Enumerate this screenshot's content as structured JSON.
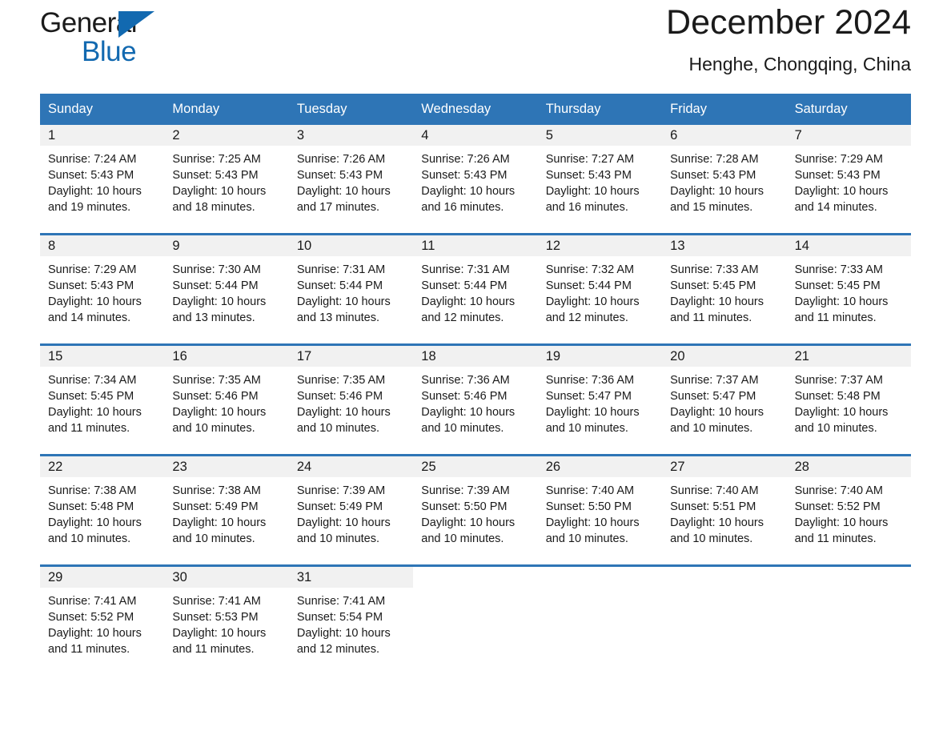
{
  "brand": {
    "name_part1": "General",
    "name_part2": "Blue",
    "triangle_color": "#1269b0"
  },
  "header": {
    "title": "December 2024",
    "subtitle": "Henghe, Chongqing, China"
  },
  "theme": {
    "header_bg": "#2e75b6",
    "header_text": "#ffffff",
    "daynum_bg": "#f1f1f1",
    "rule_color": "#2e75b6",
    "text": "#1a1a1a"
  },
  "weekdays": [
    "Sunday",
    "Monday",
    "Tuesday",
    "Wednesday",
    "Thursday",
    "Friday",
    "Saturday"
  ],
  "weeks": [
    [
      {
        "day": "1",
        "sunrise": "Sunrise: 7:24 AM",
        "sunset": "Sunset: 5:43 PM",
        "daylight_l1": "Daylight: 10 hours",
        "daylight_l2": "and 19 minutes."
      },
      {
        "day": "2",
        "sunrise": "Sunrise: 7:25 AM",
        "sunset": "Sunset: 5:43 PM",
        "daylight_l1": "Daylight: 10 hours",
        "daylight_l2": "and 18 minutes."
      },
      {
        "day": "3",
        "sunrise": "Sunrise: 7:26 AM",
        "sunset": "Sunset: 5:43 PM",
        "daylight_l1": "Daylight: 10 hours",
        "daylight_l2": "and 17 minutes."
      },
      {
        "day": "4",
        "sunrise": "Sunrise: 7:26 AM",
        "sunset": "Sunset: 5:43 PM",
        "daylight_l1": "Daylight: 10 hours",
        "daylight_l2": "and 16 minutes."
      },
      {
        "day": "5",
        "sunrise": "Sunrise: 7:27 AM",
        "sunset": "Sunset: 5:43 PM",
        "daylight_l1": "Daylight: 10 hours",
        "daylight_l2": "and 16 minutes."
      },
      {
        "day": "6",
        "sunrise": "Sunrise: 7:28 AM",
        "sunset": "Sunset: 5:43 PM",
        "daylight_l1": "Daylight: 10 hours",
        "daylight_l2": "and 15 minutes."
      },
      {
        "day": "7",
        "sunrise": "Sunrise: 7:29 AM",
        "sunset": "Sunset: 5:43 PM",
        "daylight_l1": "Daylight: 10 hours",
        "daylight_l2": "and 14 minutes."
      }
    ],
    [
      {
        "day": "8",
        "sunrise": "Sunrise: 7:29 AM",
        "sunset": "Sunset: 5:43 PM",
        "daylight_l1": "Daylight: 10 hours",
        "daylight_l2": "and 14 minutes."
      },
      {
        "day": "9",
        "sunrise": "Sunrise: 7:30 AM",
        "sunset": "Sunset: 5:44 PM",
        "daylight_l1": "Daylight: 10 hours",
        "daylight_l2": "and 13 minutes."
      },
      {
        "day": "10",
        "sunrise": "Sunrise: 7:31 AM",
        "sunset": "Sunset: 5:44 PM",
        "daylight_l1": "Daylight: 10 hours",
        "daylight_l2": "and 13 minutes."
      },
      {
        "day": "11",
        "sunrise": "Sunrise: 7:31 AM",
        "sunset": "Sunset: 5:44 PM",
        "daylight_l1": "Daylight: 10 hours",
        "daylight_l2": "and 12 minutes."
      },
      {
        "day": "12",
        "sunrise": "Sunrise: 7:32 AM",
        "sunset": "Sunset: 5:44 PM",
        "daylight_l1": "Daylight: 10 hours",
        "daylight_l2": "and 12 minutes."
      },
      {
        "day": "13",
        "sunrise": "Sunrise: 7:33 AM",
        "sunset": "Sunset: 5:45 PM",
        "daylight_l1": "Daylight: 10 hours",
        "daylight_l2": "and 11 minutes."
      },
      {
        "day": "14",
        "sunrise": "Sunrise: 7:33 AM",
        "sunset": "Sunset: 5:45 PM",
        "daylight_l1": "Daylight: 10 hours",
        "daylight_l2": "and 11 minutes."
      }
    ],
    [
      {
        "day": "15",
        "sunrise": "Sunrise: 7:34 AM",
        "sunset": "Sunset: 5:45 PM",
        "daylight_l1": "Daylight: 10 hours",
        "daylight_l2": "and 11 minutes."
      },
      {
        "day": "16",
        "sunrise": "Sunrise: 7:35 AM",
        "sunset": "Sunset: 5:46 PM",
        "daylight_l1": "Daylight: 10 hours",
        "daylight_l2": "and 10 minutes."
      },
      {
        "day": "17",
        "sunrise": "Sunrise: 7:35 AM",
        "sunset": "Sunset: 5:46 PM",
        "daylight_l1": "Daylight: 10 hours",
        "daylight_l2": "and 10 minutes."
      },
      {
        "day": "18",
        "sunrise": "Sunrise: 7:36 AM",
        "sunset": "Sunset: 5:46 PM",
        "daylight_l1": "Daylight: 10 hours",
        "daylight_l2": "and 10 minutes."
      },
      {
        "day": "19",
        "sunrise": "Sunrise: 7:36 AM",
        "sunset": "Sunset: 5:47 PM",
        "daylight_l1": "Daylight: 10 hours",
        "daylight_l2": "and 10 minutes."
      },
      {
        "day": "20",
        "sunrise": "Sunrise: 7:37 AM",
        "sunset": "Sunset: 5:47 PM",
        "daylight_l1": "Daylight: 10 hours",
        "daylight_l2": "and 10 minutes."
      },
      {
        "day": "21",
        "sunrise": "Sunrise: 7:37 AM",
        "sunset": "Sunset: 5:48 PM",
        "daylight_l1": "Daylight: 10 hours",
        "daylight_l2": "and 10 minutes."
      }
    ],
    [
      {
        "day": "22",
        "sunrise": "Sunrise: 7:38 AM",
        "sunset": "Sunset: 5:48 PM",
        "daylight_l1": "Daylight: 10 hours",
        "daylight_l2": "and 10 minutes."
      },
      {
        "day": "23",
        "sunrise": "Sunrise: 7:38 AM",
        "sunset": "Sunset: 5:49 PM",
        "daylight_l1": "Daylight: 10 hours",
        "daylight_l2": "and 10 minutes."
      },
      {
        "day": "24",
        "sunrise": "Sunrise: 7:39 AM",
        "sunset": "Sunset: 5:49 PM",
        "daylight_l1": "Daylight: 10 hours",
        "daylight_l2": "and 10 minutes."
      },
      {
        "day": "25",
        "sunrise": "Sunrise: 7:39 AM",
        "sunset": "Sunset: 5:50 PM",
        "daylight_l1": "Daylight: 10 hours",
        "daylight_l2": "and 10 minutes."
      },
      {
        "day": "26",
        "sunrise": "Sunrise: 7:40 AM",
        "sunset": "Sunset: 5:50 PM",
        "daylight_l1": "Daylight: 10 hours",
        "daylight_l2": "and 10 minutes."
      },
      {
        "day": "27",
        "sunrise": "Sunrise: 7:40 AM",
        "sunset": "Sunset: 5:51 PM",
        "daylight_l1": "Daylight: 10 hours",
        "daylight_l2": "and 10 minutes."
      },
      {
        "day": "28",
        "sunrise": "Sunrise: 7:40 AM",
        "sunset": "Sunset: 5:52 PM",
        "daylight_l1": "Daylight: 10 hours",
        "daylight_l2": "and 11 minutes."
      }
    ],
    [
      {
        "day": "29",
        "sunrise": "Sunrise: 7:41 AM",
        "sunset": "Sunset: 5:52 PM",
        "daylight_l1": "Daylight: 10 hours",
        "daylight_l2": "and 11 minutes."
      },
      {
        "day": "30",
        "sunrise": "Sunrise: 7:41 AM",
        "sunset": "Sunset: 5:53 PM",
        "daylight_l1": "Daylight: 10 hours",
        "daylight_l2": "and 11 minutes."
      },
      {
        "day": "31",
        "sunrise": "Sunrise: 7:41 AM",
        "sunset": "Sunset: 5:54 PM",
        "daylight_l1": "Daylight: 10 hours",
        "daylight_l2": "and 12 minutes."
      },
      {
        "day": "",
        "sunrise": "",
        "sunset": "",
        "daylight_l1": "",
        "daylight_l2": ""
      },
      {
        "day": "",
        "sunrise": "",
        "sunset": "",
        "daylight_l1": "",
        "daylight_l2": ""
      },
      {
        "day": "",
        "sunrise": "",
        "sunset": "",
        "daylight_l1": "",
        "daylight_l2": ""
      },
      {
        "day": "",
        "sunrise": "",
        "sunset": "",
        "daylight_l1": "",
        "daylight_l2": ""
      }
    ]
  ]
}
